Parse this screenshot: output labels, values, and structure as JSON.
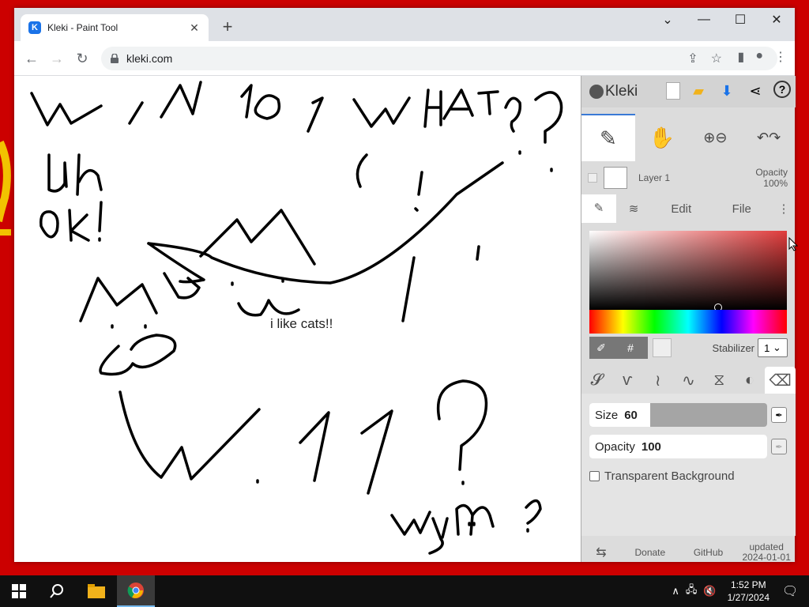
{
  "browser": {
    "tab_title": "Kleki - Paint Tool",
    "url": "kleki.com",
    "window_controls": [
      "chevron-down-icon",
      "minimize-icon",
      "maximize-icon",
      "close-icon"
    ]
  },
  "canvas": {
    "text": "i like cats!!"
  },
  "kleki": {
    "logo": "Kleki",
    "layer_name": "Layer 1",
    "layer_opacity_label": "Opacity",
    "layer_opacity_value": "100%",
    "tabs": [
      "Edit",
      "File"
    ],
    "stabilizer_label": "Stabilizer",
    "stabilizer_value": "1",
    "size_label": "Size",
    "size_value": "60",
    "size_fraction": 0.34,
    "opacity_label": "Opacity",
    "opacity_value": "100",
    "opacity_fraction": 1.0,
    "transparent_bg_label": "Transparent Background",
    "footer": {
      "donate": "Donate",
      "github": "GitHub",
      "updated_label": "updated",
      "updated_date": "2024-01-01"
    }
  },
  "taskbar": {
    "time": "1:52 PM",
    "date": "1/27/2024"
  }
}
